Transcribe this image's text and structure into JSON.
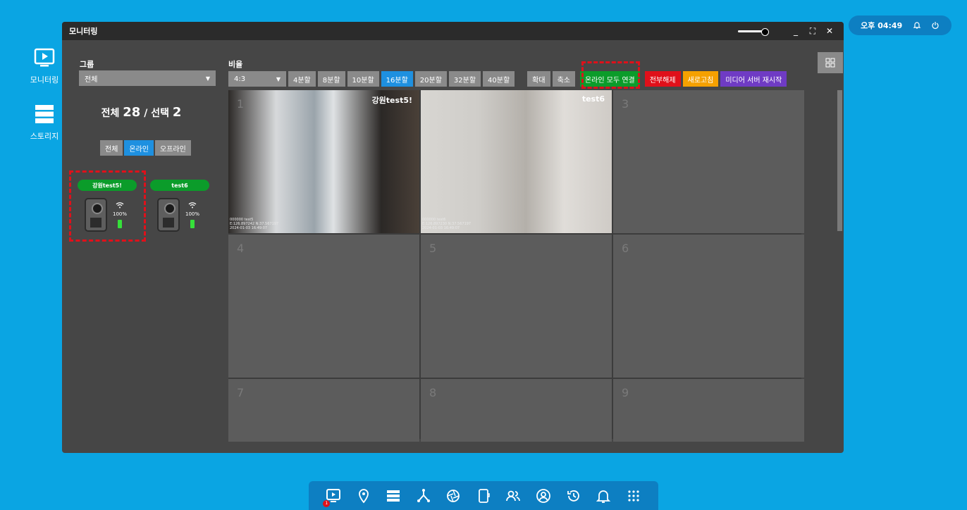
{
  "desktop": {
    "icons": [
      {
        "label": "모니터링",
        "icon": "monitor-play-icon"
      },
      {
        "label": "스토리지",
        "icon": "storage-icon"
      }
    ]
  },
  "status": {
    "time": "오후 04:49",
    "icons": [
      "bell-icon",
      "power-icon"
    ]
  },
  "window": {
    "title": "모니터링",
    "controls": [
      "_",
      "⛶",
      "✕"
    ]
  },
  "group": {
    "label": "그룹",
    "value": "전체"
  },
  "ratio": {
    "label": "비율",
    "value": "4:3"
  },
  "summary": {
    "prefix": "전체",
    "total": "28",
    "sep": "/ 선택",
    "selected": "2"
  },
  "filters": [
    {
      "label": "전체",
      "active": false
    },
    {
      "label": "온라인",
      "active": true
    },
    {
      "label": "오프라인",
      "active": false
    }
  ],
  "devices": [
    {
      "name": "강원test5!",
      "battery": "100%"
    },
    {
      "name": "test6",
      "battery": "100%"
    }
  ],
  "toolbar": {
    "splits": [
      {
        "label": "4분할",
        "active": false
      },
      {
        "label": "8분할",
        "active": false
      },
      {
        "label": "10분할",
        "active": false
      },
      {
        "label": "16분할",
        "active": true
      },
      {
        "label": "20분할",
        "active": false
      },
      {
        "label": "32분할",
        "active": false
      },
      {
        "label": "40분할",
        "active": false
      }
    ],
    "zoom_in": "확대",
    "zoom_out": "축소",
    "connect_all": "온라인 모두 연결",
    "release_all": "전부해제",
    "refresh": "새로고침",
    "restart_media": "미디어 서버 재시작"
  },
  "colors": {
    "connect": "#0b9c2a",
    "release": "#e0101a",
    "refresh": "#f5a100",
    "restart": "#6f3bc4",
    "active": "#1e90e0"
  },
  "cells": [
    {
      "num": "1",
      "name": "강원test5!",
      "osd": [
        "000000 test5",
        "E:126.897242  N:37.567197",
        "2024-01-03 16:49:07"
      ]
    },
    {
      "num": "",
      "name": "test6",
      "osd": [
        "000000 test6",
        "E:126.897230  N:37.567197",
        "2024-01-03 16:49:07"
      ]
    },
    {
      "num": "3",
      "name": "",
      "osd": []
    },
    {
      "num": "4",
      "name": "",
      "osd": []
    },
    {
      "num": "5",
      "name": "",
      "osd": []
    },
    {
      "num": "6",
      "name": "",
      "osd": []
    },
    {
      "num": "7",
      "name": "",
      "osd": []
    },
    {
      "num": "8",
      "name": "",
      "osd": []
    },
    {
      "num": "9",
      "name": "",
      "osd": []
    }
  ],
  "taskbar": {
    "icons": [
      "monitoring-icon",
      "location-icon",
      "storage-icon",
      "network-icon",
      "shutter-icon",
      "device-icon",
      "users-icon",
      "account-icon",
      "history-icon",
      "bell-icon",
      "apps-grid-icon"
    ],
    "badge": "1"
  }
}
